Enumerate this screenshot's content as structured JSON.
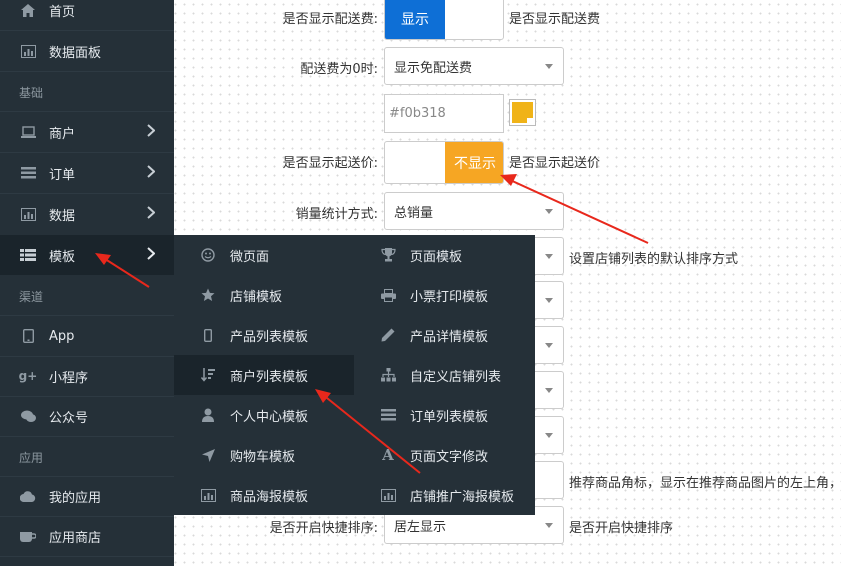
{
  "sidebar": {
    "items": [
      {
        "label": "首页",
        "icon": "home-icon"
      },
      {
        "label": "数据面板",
        "icon": "chart-icon"
      },
      {
        "label": "商户",
        "icon": "laptop-icon"
      },
      {
        "label": "订单",
        "icon": "list-icon"
      },
      {
        "label": "数据",
        "icon": "bar-chart-icon"
      },
      {
        "label": "模板",
        "icon": "grid-list-icon"
      },
      {
        "label": "App",
        "icon": "tablet-icon"
      },
      {
        "label": "小程序",
        "icon": "google-plus-icon"
      },
      {
        "label": "公众号",
        "icon": "chat-icon"
      },
      {
        "label": "我的应用",
        "icon": "cloud-icon"
      },
      {
        "label": "应用商店",
        "icon": "coffee-icon"
      }
    ],
    "sections": [
      "基础",
      "渠道",
      "应用"
    ]
  },
  "flyout": {
    "left": [
      {
        "label": "微页面",
        "icon": "smile-icon"
      },
      {
        "label": "店铺模板",
        "icon": "star-icon"
      },
      {
        "label": "产品列表模板",
        "icon": "mobile-icon"
      },
      {
        "label": "商户列表模板",
        "icon": "sort-icon"
      },
      {
        "label": "个人中心模板",
        "icon": "user-icon"
      },
      {
        "label": "购物车模板",
        "icon": "location-arrow-icon"
      },
      {
        "label": "商品海报模板",
        "icon": "bar-chart-icon"
      }
    ],
    "right": [
      {
        "label": "页面模板",
        "icon": "trophy-icon"
      },
      {
        "label": "小票打印模板",
        "icon": "print-icon"
      },
      {
        "label": "产品详情模板",
        "icon": "pencil-icon"
      },
      {
        "label": "自定义店铺列表",
        "icon": "sitemap-icon"
      },
      {
        "label": "订单列表模板",
        "icon": "list-icon"
      },
      {
        "label": "页面文字修改",
        "icon": "font-icon"
      },
      {
        "label": "店铺推广海报模板",
        "icon": "bar-chart-icon"
      }
    ]
  },
  "form": {
    "show_delivery_fee": {
      "label": "是否显示配送费:",
      "button": "显示",
      "hint": "是否显示配送费"
    },
    "zero_fee": {
      "label": "配送费为0时:",
      "value": "显示免配送费"
    },
    "color": {
      "value": "#f0b318",
      "swatch": "#f0b318"
    },
    "show_min_price": {
      "label": "是否显示起送价:",
      "button": "不显示",
      "hint": "是否显示起送价"
    },
    "sales_method": {
      "label": "销量统计方式:",
      "value": "总销量"
    },
    "store_sort_hint": "设置店铺列表的默认排序方式",
    "recommend_hint": "推荐商品角标，显示在推荐商品图片的左上角，",
    "quick_sort": {
      "label": "是否开启快捷排序:",
      "value": "居左显示",
      "hint": "是否开启快捷排序"
    }
  },
  "colors": {
    "accent_blue": "#0e6fd6",
    "accent_orange": "#f6a623",
    "sidebar_bg": "#253038"
  }
}
